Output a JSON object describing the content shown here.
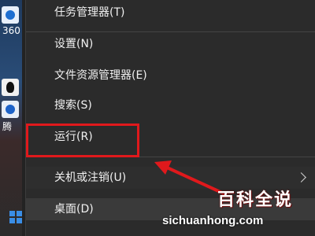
{
  "desktop": {
    "icon_label_1": "360",
    "icon_label_2": "腾"
  },
  "menu": {
    "items": [
      {
        "label": "任务管理器(T)"
      },
      {
        "label": "设置(N)"
      },
      {
        "label": "文件资源管理器(E)"
      },
      {
        "label": "搜索(S)"
      },
      {
        "label": "运行(R)"
      },
      {
        "label": "关机或注销(U)"
      },
      {
        "label": "桌面(D)"
      }
    ]
  },
  "annotation": {
    "highlight_color": "#e0191c",
    "arrow_color": "#e0191c"
  },
  "watermark": {
    "brand": "百科全说",
    "site": "sichuanhong.com"
  }
}
